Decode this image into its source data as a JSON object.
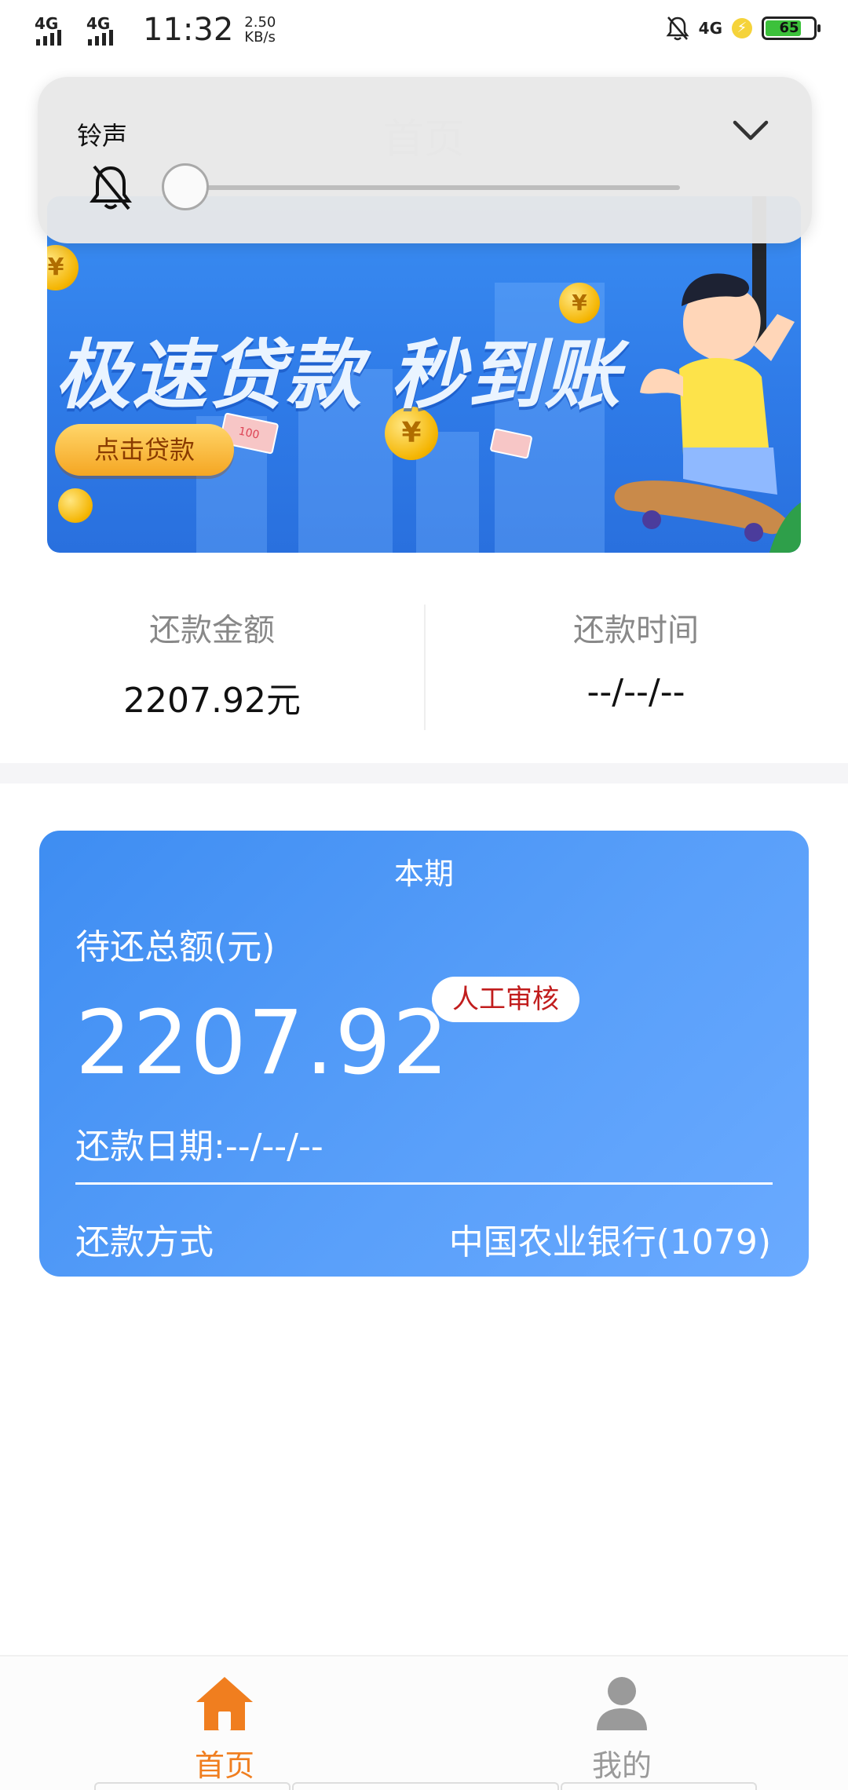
{
  "status_bar": {
    "signal1_label": "4G",
    "signal2_label": "4G",
    "time": "11:32",
    "speed_value": "2.50",
    "speed_unit": "KB/s",
    "network_label": "4G",
    "battery_level": "65"
  },
  "header": {
    "title": "首页"
  },
  "volume_panel": {
    "label": "铃声",
    "level": 0
  },
  "banner": {
    "title": "极速贷款 秒到账",
    "button_label": "点击贷款",
    "coin_symbol": "¥",
    "cash_label": "100"
  },
  "summary": {
    "amount_label": "还款金额",
    "amount_value": "2207.92元",
    "time_label": "还款时间",
    "time_value": "--/--/--"
  },
  "card": {
    "period": "本期",
    "total_label": "待还总额(元)",
    "total_amount": "2207.92",
    "badge": "人工审核",
    "due_date": "还款日期:--/--/--",
    "method_label": "还款方式",
    "method_value": "中国农业银行(1079)"
  },
  "bottom_nav": {
    "home_label": "首页",
    "mine_label": "我的",
    "active_color": "#f07e1f",
    "inactive_color": "#9a9a9a"
  }
}
